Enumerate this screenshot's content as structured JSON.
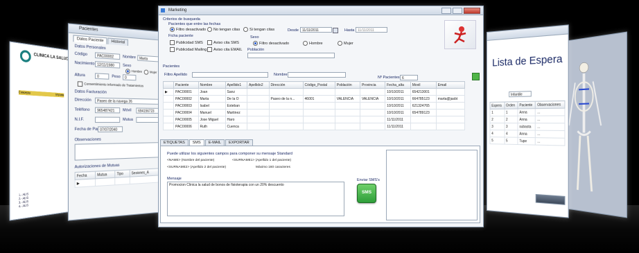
{
  "left_doc": {
    "brand": "CLINICA LA SALUD",
    "header_cols": [
      "Concepto",
      "Importe"
    ],
    "footer": [
      "1.- ALIS",
      "2.- ALIS",
      "3.- ALIS",
      "4.- ALIS"
    ]
  },
  "pacientes_win": {
    "title": "Pacientes",
    "tabs": [
      "Datos Paciente",
      "Historial"
    ],
    "section_personal": "Datos Personales",
    "fields": [
      {
        "label": "Código",
        "value": "PAC00002"
      },
      {
        "label": "Nombre",
        "value": "Marta"
      },
      {
        "label": "Nacimiento",
        "value": "12/11/1980"
      },
      {
        "label": "Sexo",
        "value": ""
      },
      {
        "label": "Altura",
        "value": "0"
      },
      {
        "label": "Peso",
        "value": "0"
      }
    ],
    "radio_hombre": "Hombre",
    "radio_mujer": "Mujer",
    "consent": "Consentimiento Informado de Tratamientos",
    "section_fact": "Datos Facturación",
    "direccion_label": "Dirección",
    "direccion_value": "Paseo de la navega 26",
    "telefono_label": "Teléfono",
    "telefono_value": "965487421",
    "movil_label": "Móvil",
    "movil_value": "694156723",
    "nif_label": "N.I.F.",
    "mutua_label": "Mutua",
    "fecha_label": "Fecha de Pago",
    "fecha_value": "07/07/2040",
    "obs_label": "Observaciones",
    "aut_label": "Autorizaciones de Mutuas",
    "aut_cols": [
      "Fecha",
      "Mutua",
      "Tipo",
      "Sesiones_A"
    ]
  },
  "marketing": {
    "title": "Marketing",
    "criterios": "Criterios de busqueda",
    "pacientes_entre": "Pacientes que entre las fechas",
    "filtro_desactivado": "Filtro desactivado",
    "no_tengan": "No tengan citas",
    "si_tengan": "Si tengan citas",
    "desde_label": "Desde",
    "desde_value": "11/11/2011",
    "hasta_label": "Hasta",
    "hasta_value": "11/11/2011",
    "ficha": "Ficha paciente",
    "pub_sms": "Publicidad SMS",
    "pub_mailing": "Publicidad Mailing",
    "avisos_sms": "Aviso cita SMS",
    "avisos_email": "Aviso cita EMAIL",
    "sexo": "Sexo",
    "sexo_filtro": "Filtro desactivado",
    "sexo_hombre": "Hombre",
    "sexo_mujer": "Mujer",
    "poblacion": "Población",
    "pacientes_heading": "Pacientes",
    "filtro_apellido": "Filtro Apellido",
    "nombre_label": "Nombre",
    "n_pacientes_label": "Nº Pacientes",
    "n_pacientes_value": "6",
    "columns": [
      "Paciente",
      "Nombre",
      "Apellido1",
      "Apellido2",
      "Dirección",
      "Código_Postal",
      "Población",
      "Provincia",
      "Fecha_alta",
      "Movil",
      "Email"
    ],
    "rows": [
      [
        "PAC00001",
        "Joan",
        "Sanz",
        "",
        "",
        "",
        "",
        "",
        "10/10/2011",
        "654213001",
        ""
      ],
      [
        "PAC00002",
        "Marta",
        "De la O",
        "",
        "Paseo de la n...",
        "46001",
        "VALENCIA",
        "VALENCIA",
        "10/10/2011",
        "664785123",
        "marta@jasbt"
      ],
      [
        "PAC00003",
        "Isabel",
        "Esteban",
        "",
        "",
        "",
        "",
        "",
        "10/10/2011",
        "621324765",
        ""
      ],
      [
        "PAC00004",
        "Manuel",
        "Martinez",
        "",
        "",
        "",
        "",
        "",
        "10/10/2011",
        "654789123",
        ""
      ],
      [
        "PAC00005",
        "Jose Miguel",
        "Haro",
        "",
        "",
        "",
        "",
        "",
        "11/11/2011",
        "",
        ""
      ],
      [
        "PAC00006",
        "Ruth",
        "Cuenca",
        "",
        "",
        "",
        "",
        "",
        "11/11/2011",
        "",
        ""
      ]
    ],
    "bottom_tabs": [
      "ETIQUETAS",
      "SMS",
      "E-MAIL",
      "EXPORTAR"
    ],
    "info_line": "Puede utilizar los siguientes campos para componer su mensaje Standard",
    "field1": "<NAME> (Nombre del paciente)",
    "field2": "<SURNAME1> (Apellido 1 del paciente)",
    "field3": "<SURNAME2> (Apellido 2 del paciente)",
    "max_chars": "Máximo 160 caracteres",
    "mensaje_label": "Mensaje",
    "mensaje_value": "Promocion Clinica la salud de bonos de fisioterapia con un 20% descuento",
    "enviar_label": "Enviar SMS's",
    "sms_button": "SMS"
  },
  "espera": {
    "title": "Lista de Espera",
    "filter_value": "Infantile",
    "cols": [
      "Espera",
      "Orden",
      "Paciente",
      "Observaciones"
    ],
    "rows": [
      [
        "1",
        "1",
        "Anna",
        "..."
      ],
      [
        "2",
        "2",
        "Anna",
        "..."
      ],
      [
        "3",
        "3",
        "subasta",
        "..."
      ],
      [
        "4",
        "4",
        "Anna",
        "..."
      ],
      [
        "5",
        "5",
        "Tupe",
        "..."
      ]
    ]
  },
  "colors": {
    "accent": "#1b3fa8",
    "sms_green": "#2e9e3a"
  }
}
